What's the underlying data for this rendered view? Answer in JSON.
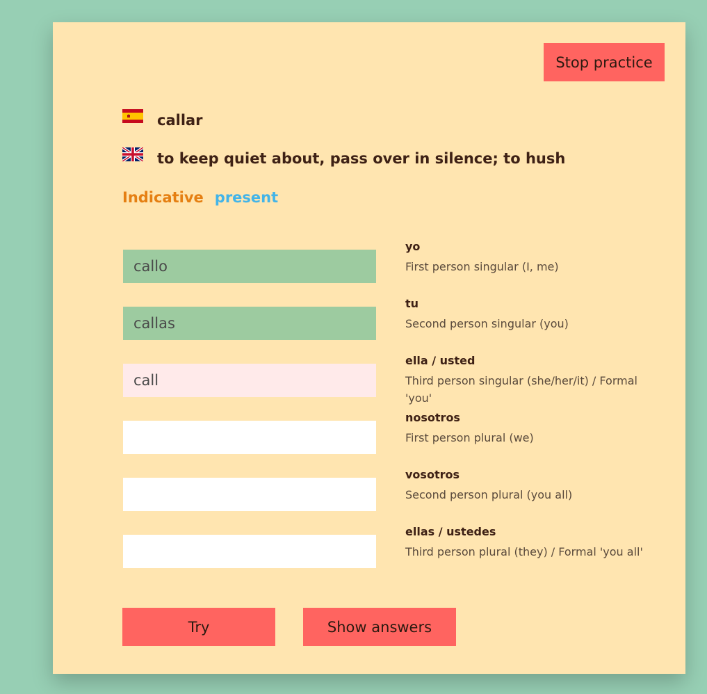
{
  "header": {
    "stop_label": "Stop practice"
  },
  "verb": {
    "spanish": "callar",
    "english": "to keep quiet about, pass over in silence; to hush",
    "flag_spanish": "spain-flag-icon",
    "flag_english": "uk-flag-icon"
  },
  "mode": {
    "mood": "Indicative",
    "tense": "present",
    "mood_color": "#e57f12",
    "tense_color": "#43b4e8"
  },
  "rows": [
    {
      "value": "callo",
      "state": "correct",
      "pronoun": "yo",
      "description": "First person singular (I, me)"
    },
    {
      "value": "callas",
      "state": "correct",
      "pronoun": "tu",
      "description": "Second person singular (you)"
    },
    {
      "value": "call",
      "state": "wrong",
      "pronoun": "ella / usted",
      "description": "Third person singular (she/her/it) / Formal 'you'"
    },
    {
      "value": "",
      "state": "empty",
      "pronoun": "nosotros",
      "description": "First person plural (we)"
    },
    {
      "value": "",
      "state": "empty",
      "pronoun": "vosotros",
      "description": "Second person plural (you all)"
    },
    {
      "value": "",
      "state": "empty",
      "pronoun": "ellas / ustedes",
      "description": "Third person plural (they) / Formal 'you all'"
    }
  ],
  "actions": {
    "try_label": "Try",
    "show_label": "Show answers"
  },
  "colors": {
    "background": "#97cfb4",
    "card": "#ffe5b0",
    "button": "#ff6460",
    "correct": "#9dcba0",
    "wrong": "#ffeaea"
  }
}
